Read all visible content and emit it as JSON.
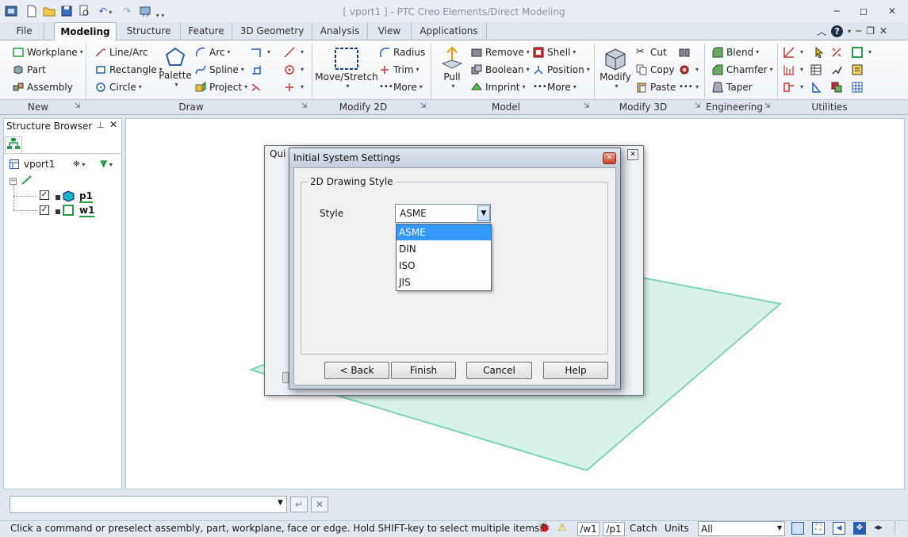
{
  "window": {
    "title": "[ vport1 ] - PTC Creo Elements/Direct Modeling"
  },
  "quick_access": {
    "icons": [
      "app-menu-icon",
      "new-file-icon",
      "open-file-icon",
      "save-icon",
      "print-preview-icon",
      "undo-icon",
      "redo-icon",
      "settings-icon"
    ]
  },
  "tabs": [
    {
      "label": "File"
    },
    {
      "label": "Modeling"
    },
    {
      "label": "Structure"
    },
    {
      "label": "Feature"
    },
    {
      "label": "3D Geometry"
    },
    {
      "label": "Analysis"
    },
    {
      "label": "View"
    },
    {
      "label": "Applications"
    }
  ],
  "ribbon": {
    "new": {
      "label": "New",
      "items": [
        "Workplane",
        "Part",
        "Assembly"
      ]
    },
    "draw": {
      "label": "Draw",
      "items": [
        "Line/Arc",
        "Rectangle",
        "Circle",
        "Arc",
        "Spline",
        "Project"
      ],
      "palette": "Palette"
    },
    "modify2d": {
      "label": "Modify 2D",
      "big": "Move/Stretch",
      "items": [
        "Radius",
        "Trim",
        "More"
      ]
    },
    "model": {
      "label": "Model",
      "big": "Pull",
      "items": [
        "Remove",
        "Boolean",
        "Imprint",
        "Shell",
        "Position",
        "More"
      ]
    },
    "modify3d": {
      "label": "Modify 3D",
      "big": "Modify",
      "items": [
        "Cut",
        "Copy",
        "Paste"
      ]
    },
    "engineering": {
      "label": "Engineering",
      "items": [
        "Blend",
        "Chamfer",
        "Taper"
      ]
    },
    "utilities": {
      "label": "Utilities"
    }
  },
  "browser": {
    "title": "Structure Browser",
    "root": "vport1",
    "items": [
      {
        "label": "p1"
      },
      {
        "label": "w1"
      }
    ]
  },
  "back_dialog": {
    "title_fragment": "Qui"
  },
  "dialog": {
    "title": "Initial System Settings",
    "group_label": "2D Drawing Style",
    "field_label": "Style",
    "selected_value": "ASME",
    "options": [
      "ASME",
      "DIN",
      "ISO",
      "JIS"
    ],
    "buttons": {
      "back": "< Back",
      "finish": "Finish",
      "cancel": "Cancel",
      "help": "Help"
    }
  },
  "command_bar": {
    "value": ""
  },
  "status": {
    "message": "Click a command or preselect assembly, part, workplane, face or edge. Hold SHIFT-key to select multiple items.",
    "workplane": "/w1",
    "part": "/p1",
    "catch": "Catch",
    "units": "Units",
    "filter": "All"
  },
  "colors": {
    "accent": "#3399ff",
    "workplane_fill": "#d8f2ea",
    "workplane_edge": "#7fd3b8"
  }
}
